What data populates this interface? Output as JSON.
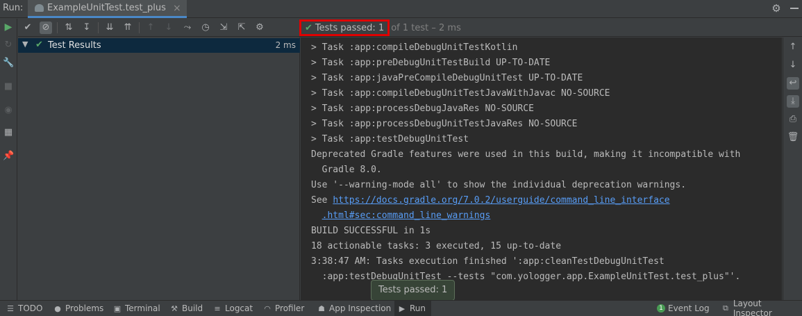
{
  "titlebar": {
    "run_label": "Run:",
    "tab_title": "ExampleUnitTest.test_plus",
    "tab_close": "×"
  },
  "toolbar": {
    "status_passed": "Tests passed: 1",
    "status_rest": "of 1 test – 2 ms"
  },
  "tree": {
    "root_label": "Test Results",
    "root_time": "2 ms"
  },
  "console": {
    "lines": [
      "> Task :app:compileDebugUnitTestKotlin",
      "> Task :app:preDebugUnitTestBuild UP-TO-DATE",
      "> Task :app:javaPreCompileDebugUnitTest UP-TO-DATE",
      "> Task :app:compileDebugUnitTestJavaWithJavac NO-SOURCE",
      "> Task :app:processDebugJavaRes NO-SOURCE",
      "> Task :app:processDebugUnitTestJavaRes NO-SOURCE",
      "> Task :app:testDebugUnitTest",
      "Deprecated Gradle features were used in this build, making it incompatible with",
      "  Gradle 8.0.",
      "Use '--warning-mode all' to show the individual deprecation warnings.",
      "See ",
      "  ",
      "BUILD SUCCESSFUL in 1s",
      "18 actionable tasks: 3 executed, 15 up-to-date",
      "3:38:47 AM: Tasks execution finished ':app:cleanTestDebugUnitTest",
      "  :app:testDebugUnitTest --tests \"com.yologger.app.ExampleUnitTest.test_plus\"'."
    ],
    "link_part1": "https://docs.gradle.org/7.0.2/userguide/command_line_interface",
    "link_part2": ".html#sec:command_line_warnings"
  },
  "tooltip": {
    "text": "Tests passed: 1"
  },
  "bottombar": {
    "todo": "TODO",
    "problems": "Problems",
    "terminal": "Terminal",
    "build": "Build",
    "logcat": "Logcat",
    "profiler": "Profiler",
    "app_inspection": "App Inspection",
    "run": "Run",
    "event_log": "Event Log",
    "event_log_count": "1",
    "layout_inspector": "Layout Inspector"
  },
  "colors": {
    "accent": "#4a88c7",
    "success": "#59a869",
    "link": "#589df6",
    "highlight_border": "#e00000"
  }
}
